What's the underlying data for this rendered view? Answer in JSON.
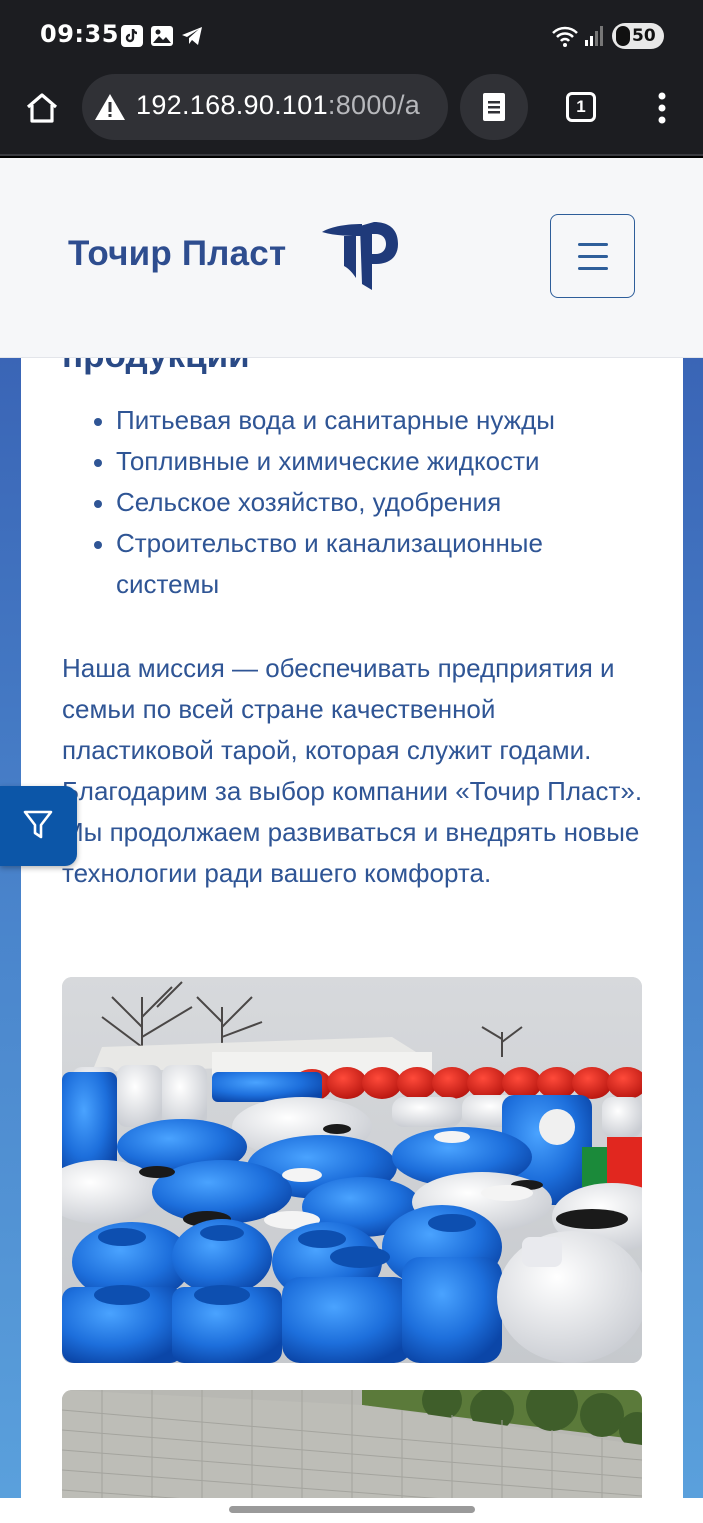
{
  "status_bar": {
    "time": "09:35",
    "battery": "50",
    "icons": [
      "tiktok-notification-icon",
      "gallery-notification-icon",
      "telegram-notification-icon",
      "wifi-icon",
      "signal-icon",
      "battery-charging-icon"
    ]
  },
  "browser": {
    "url_main": "192.168.90.101",
    "url_rest": ":8000/a",
    "tab_count": "1",
    "icons": [
      "home-icon",
      "not-secure-warning-icon",
      "reader-mode-icon",
      "tabs-icon",
      "overflow-menu-icon"
    ]
  },
  "header": {
    "brand": "Точир Пласт",
    "brand_color": "#2e4d8f",
    "logo_icon": "tochir-plast-logo-icon",
    "menu_icon": "hamburger-menu-icon"
  },
  "content": {
    "heading_cut": "продукции",
    "bullets": [
      "Питьевая вода и санитарные нужды",
      "Топливные и химические жидкости",
      "Сельское хозяйство, удобрения",
      "Строительство и канализационные системы"
    ],
    "mission": "Наша миссия — обеспечивать предприятия и семьи по всей стране качественной пластиковой тарой, которая служит годами. Благодарим за выбор компании «Точир Пласт». Мы продолжаем развиваться и внедрять новые технологии ради вашего комфорта.",
    "text_color": "#2f5595"
  },
  "filter": {
    "icon": "filter-icon",
    "color": "#0c56a8"
  }
}
